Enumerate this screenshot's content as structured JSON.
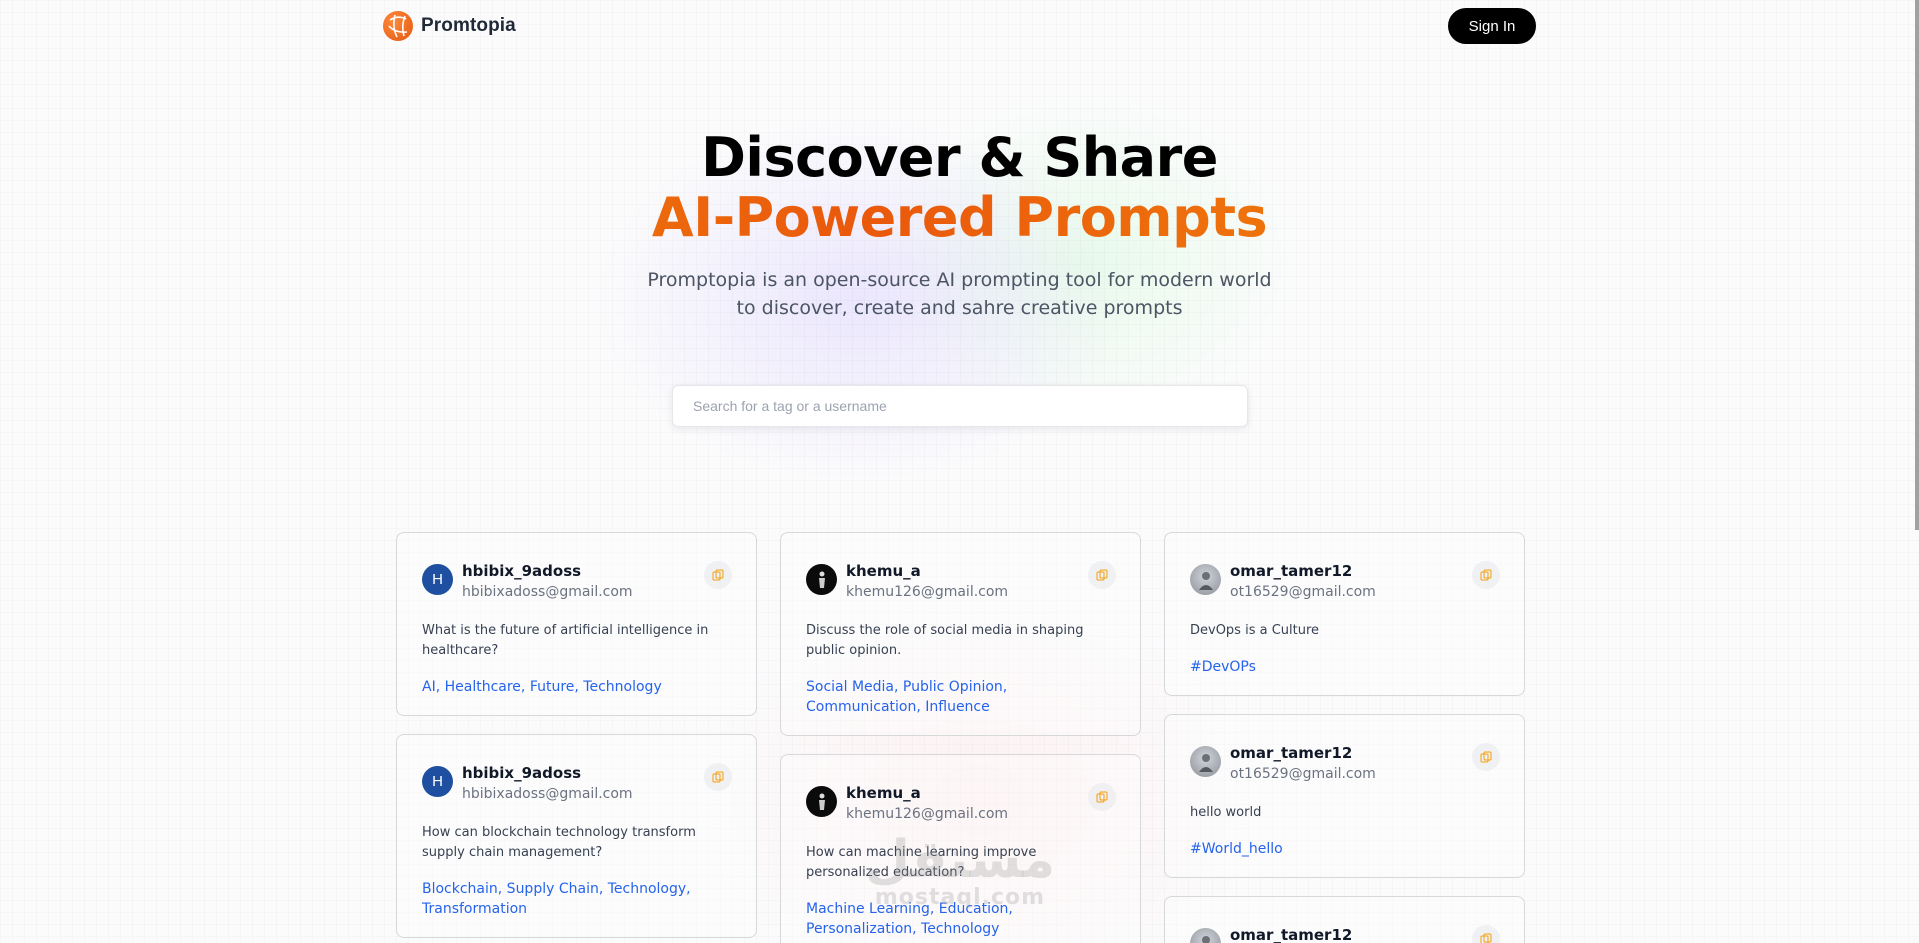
{
  "header": {
    "brand": "Promtopia",
    "sign_in": "Sign In"
  },
  "hero": {
    "title_line1": "Discover & Share",
    "title_line2": "AI-Powered Prompts",
    "subtitle": "Promptopia is an open-source AI prompting tool for modern world to discover, create and sahre creative prompts"
  },
  "search": {
    "placeholder": "Search for a tag or a username",
    "value": ""
  },
  "colors": {
    "accent_start": "#f59e0b",
    "accent_mid": "#ea580c",
    "tag_link": "#2563eb",
    "avatar_blue": "#1e4fa0"
  },
  "cards": [
    {
      "avatar_initial": "H",
      "username": "hbibix_9adoss",
      "email": "hbibixadoss@gmail.com",
      "prompt": "What is the future of artificial intelligence in healthcare?",
      "tags": "AI, Healthcare, Future, Technology",
      "copy_icon": "copy-icon"
    },
    {
      "avatar_initial": "H",
      "username": "hbibix_9adoss",
      "email": "hbibixadoss@gmail.com",
      "prompt": "How can blockchain technology transform supply chain management?",
      "tags": "Blockchain, Supply Chain, Technology, Transformation",
      "copy_icon": "copy-icon"
    },
    {
      "username": "khemu_a",
      "email": "khemu126@gmail.com",
      "prompt": "Discuss the role of social media in shaping public opinion.",
      "tags": "Social Media, Public Opinion, Communication, Influence",
      "copy_icon": "copy-icon"
    },
    {
      "username": "khemu_a",
      "email": "khemu126@gmail.com",
      "prompt": "How can machine learning improve personalized education?",
      "tags": "Machine Learning, Education, Personalization, Technology",
      "copy_icon": "copy-icon"
    },
    {
      "username": "omar_tamer12",
      "email": "ot16529@gmail.com",
      "prompt": "DevOps is a Culture",
      "tags": "#DevOPs",
      "copy_icon": "copy-icon"
    },
    {
      "username": "omar_tamer12",
      "email": "ot16529@gmail.com",
      "prompt": "hello world",
      "tags": "#World_hello",
      "copy_icon": "copy-icon"
    },
    {
      "username": "omar_tamer12",
      "copy_icon": "copy-icon"
    }
  ],
  "watermark": {
    "arabic": "مستقل",
    "latin": "mostaql.com"
  }
}
